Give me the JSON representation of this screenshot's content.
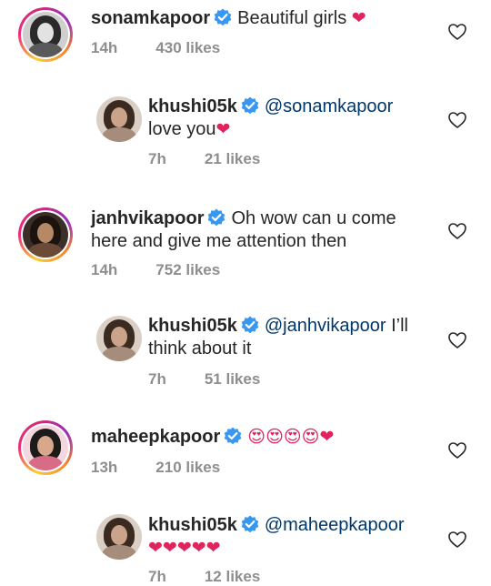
{
  "comments": [
    {
      "username": "sonamkapoor",
      "text_pre": "",
      "mention": "",
      "text": "Beautiful girls ",
      "emoji": "❤",
      "time": "14h",
      "likes": "430 likes"
    },
    {
      "username": "khushi05k",
      "mention": "@sonamkapoor",
      "text": "love you",
      "emoji": "❤",
      "time": "7h",
      "likes": "21 likes"
    },
    {
      "username": "janhvikapoor",
      "text": "Oh wow can u come",
      "text2": "here and give me attention then",
      "time": "14h",
      "likes": "752 likes"
    },
    {
      "username": "khushi05k",
      "mention": "@janhvikapoor",
      "text": " I’ll",
      "text2": "think about it",
      "time": "7h",
      "likes": "51 likes"
    },
    {
      "username": "maheepkapoor",
      "emoji": "😍😍😍😍❤",
      "time": "13h",
      "likes": "210 likes"
    },
    {
      "username": "khushi05k",
      "mention": "@maheepkapoor",
      "emoji": "❤❤❤❤❤",
      "time": "7h",
      "likes": "12 likes"
    }
  ],
  "colors": {
    "link": "#00376b",
    "meta": "#8e8e8e",
    "verified": "#3897f0",
    "heart": "#e0245e"
  },
  "icons": {
    "verified": "verified-badge-icon",
    "like": "heart-outline-icon"
  }
}
